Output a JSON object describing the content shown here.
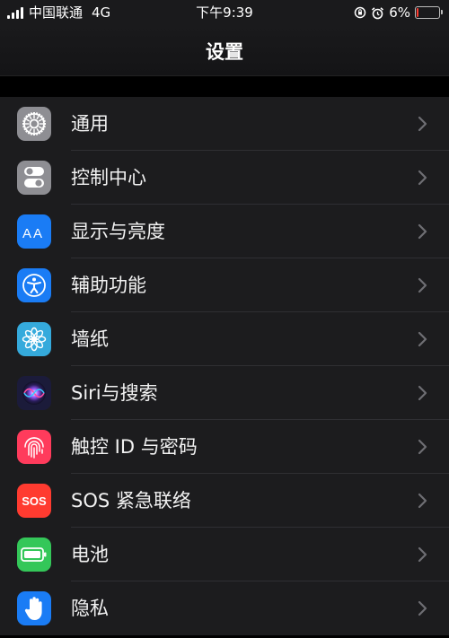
{
  "status_bar": {
    "carrier": "中国联通",
    "network": "4G",
    "time": "下午9:39",
    "battery_percent": "6%",
    "battery_level": 0.06,
    "icons": [
      "signal-icon",
      "rotation-lock-icon",
      "alarm-icon",
      "battery-icon"
    ]
  },
  "nav": {
    "title": "设置"
  },
  "settings": [
    {
      "label": "通用",
      "icon": "gear-icon",
      "color": "#8e8e93"
    },
    {
      "label": "控制中心",
      "icon": "toggles-icon",
      "color": "#8e8e93"
    },
    {
      "label": "显示与亮度",
      "icon": "text-size-icon",
      "color": "#1a7cf5"
    },
    {
      "label": "辅助功能",
      "icon": "accessibility-icon",
      "color": "#1a7cf5"
    },
    {
      "label": "墙纸",
      "icon": "flower-icon",
      "color": "#35aadc"
    },
    {
      "label": "Siri与搜索",
      "icon": "siri-icon",
      "color": "#1b1b3a"
    },
    {
      "label": "触控 ID 与密码",
      "icon": "fingerprint-icon",
      "color": "#ff3b5c"
    },
    {
      "label": "SOS 紧急联络",
      "icon": "sos-icon",
      "color": "#ff3b30"
    },
    {
      "label": "电池",
      "icon": "battery-icon",
      "color": "#34c759"
    },
    {
      "label": "隐私",
      "icon": "hand-icon",
      "color": "#1a7cf5"
    }
  ]
}
